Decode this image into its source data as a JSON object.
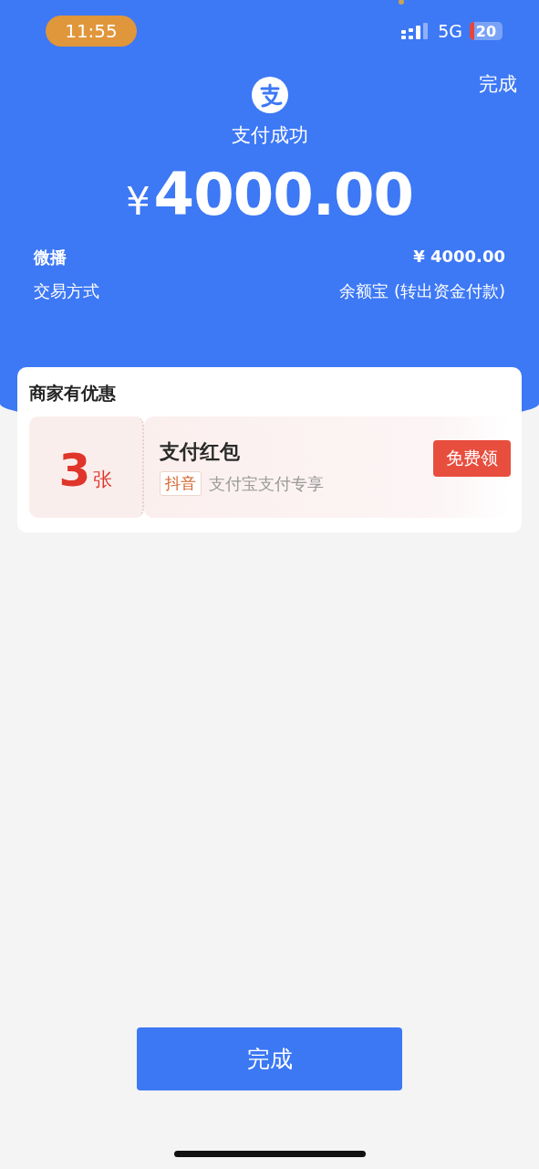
{
  "status_bar": {
    "time": "11:55",
    "network": "5G",
    "battery": "20"
  },
  "header": {
    "done_link": "完成",
    "title": "支付成功",
    "currency": "¥",
    "amount": "4000.00"
  },
  "details": [
    {
      "label": "微播",
      "value": "¥ 4000.00",
      "bold": true
    },
    {
      "label": "交易方式",
      "value": "余额宝 (转出资金付款)",
      "bold": false
    }
  ],
  "offers": {
    "title": "商家有优惠",
    "coupon": {
      "count": "3",
      "unit": "张",
      "name": "支付红包",
      "tag": "抖音",
      "description": "支付宝支付专享",
      "button": "免费领"
    }
  },
  "done_button": "完成"
}
